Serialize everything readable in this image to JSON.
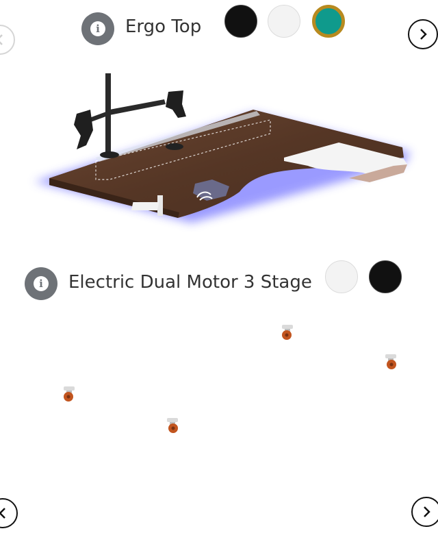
{
  "top_option": {
    "title": "Ergo Top",
    "icon": "info-icon",
    "swatches": [
      {
        "name": "black",
        "color": "#111111",
        "selected": false
      },
      {
        "name": "white",
        "color": "#f3f3f3",
        "selected": false
      },
      {
        "name": "teal",
        "color": "#0f9a8c",
        "selected": true
      }
    ]
  },
  "frame_option": {
    "title": "Electric Dual Motor 3 Stage",
    "icon": "info-icon",
    "swatches": [
      {
        "name": "white",
        "color": "#f3f3f3",
        "selected": false
      },
      {
        "name": "black",
        "color": "#111111",
        "selected": false
      }
    ]
  },
  "navigation": {
    "top_prev_icon": "chevron-left-icon",
    "top_next_icon": "chevron-right-icon",
    "bottom_prev_icon": "chevron-left-icon",
    "bottom_next_icon": "chevron-right-icon"
  },
  "colors": {
    "desk_wood": "#5a3a28",
    "led_glow": "#4a4aff",
    "selected_ring": "#b88a1f"
  }
}
